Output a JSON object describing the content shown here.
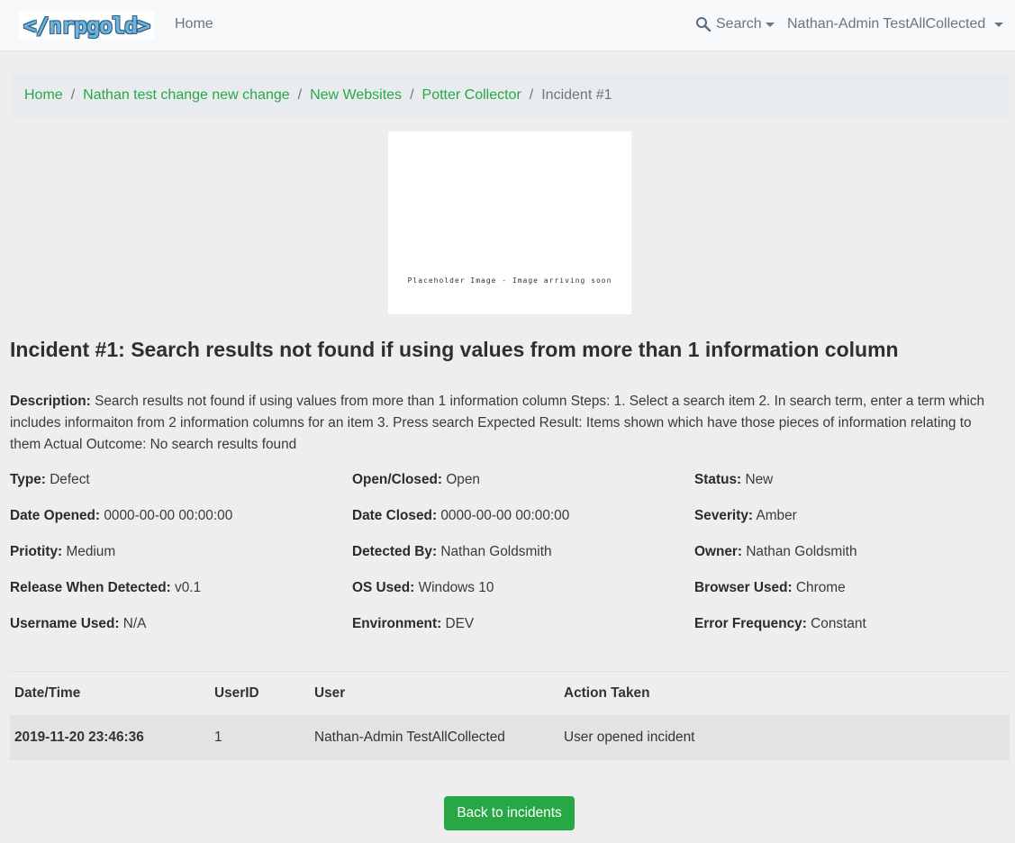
{
  "navbar": {
    "brand": "</nrpgold>",
    "home": "Home",
    "search": "Search",
    "user": "Nathan-Admin TestAllCollected"
  },
  "breadcrumb": [
    {
      "label": "Home",
      "active": false
    },
    {
      "label": "Nathan test change new change",
      "active": false
    },
    {
      "label": "New Websites",
      "active": false
    },
    {
      "label": "Potter Collector",
      "active": false
    },
    {
      "label": "Incident #1",
      "active": true
    }
  ],
  "breadcrumb_separator": "/",
  "image": {
    "caption": "Placeholder Image - Image arriving soon"
  },
  "incident": {
    "title": "Incident #1: Search results not found if using values from more than 1 information column",
    "description_label": "Description:",
    "description": "Search results not found if using values from more than 1 information column Steps: 1. Select a search item 2. In search term, enter a term which includes informaiton from 2 information columns for an item 3. Press search Expected Result: Items shown which have those pieces of information relating to them Actual Outcome: No search results found",
    "fields": {
      "type": {
        "label": "Type:",
        "value": "Defect"
      },
      "open_closed": {
        "label": "Open/Closed:",
        "value": "Open"
      },
      "status": {
        "label": "Status:",
        "value": "New"
      },
      "date_opened": {
        "label": "Date Opened:",
        "value": "0000-00-00 00:00:00"
      },
      "date_closed": {
        "label": "Date Closed:",
        "value": "0000-00-00 00:00:00"
      },
      "severity": {
        "label": "Severity:",
        "value": "Amber"
      },
      "priority": {
        "label": "Priotity:",
        "value": "Medium"
      },
      "detected_by": {
        "label": "Detected By:",
        "value": "Nathan Goldsmith"
      },
      "owner": {
        "label": "Owner:",
        "value": "Nathan Goldsmith"
      },
      "release": {
        "label": "Release When Detected:",
        "value": "v0.1"
      },
      "os_used": {
        "label": "OS Used:",
        "value": "Windows 10"
      },
      "browser_used": {
        "label": "Browser Used:",
        "value": "Chrome"
      },
      "username_used": {
        "label": "Username Used:",
        "value": "N/A"
      },
      "environment": {
        "label": "Environment:",
        "value": "DEV"
      },
      "error_frequency": {
        "label": "Error Frequency:",
        "value": "Constant"
      }
    }
  },
  "history": {
    "columns": [
      "Date/Time",
      "UserID",
      "User",
      "Action Taken"
    ],
    "rows": [
      [
        "2019-11-20 23:46:36",
        "1",
        "Nathan-Admin TestAllCollected",
        "User opened incident"
      ]
    ]
  },
  "back_button": "Back to incidents",
  "colors": {
    "accent": "#28a745",
    "background": "#eeeeee",
    "navbar": "#f8f9fa",
    "breadcrumb_bg": "#e9ecef"
  }
}
